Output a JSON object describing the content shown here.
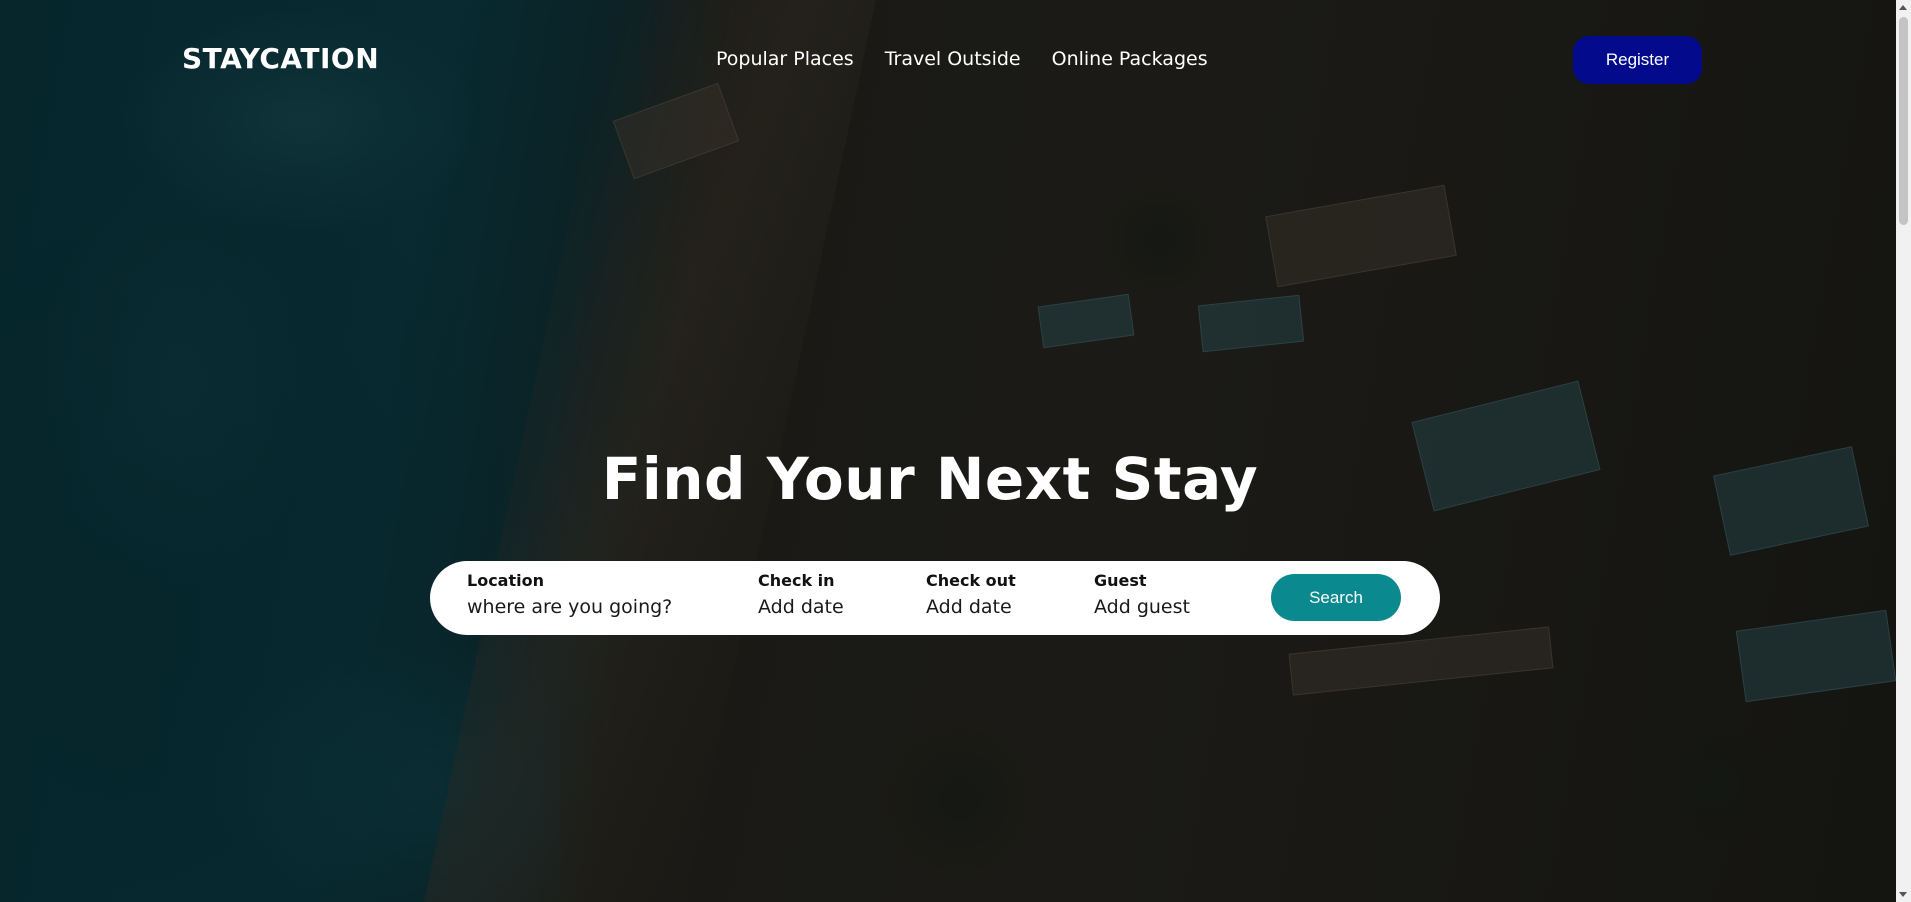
{
  "header": {
    "logo": "STAYCATION",
    "nav": [
      {
        "label": "Popular Places"
      },
      {
        "label": "Travel Outside"
      },
      {
        "label": "Online Packages"
      }
    ],
    "register_label": "Register"
  },
  "hero": {
    "title": "Find Your Next Stay"
  },
  "search": {
    "fields": [
      {
        "label": "Location",
        "value": "where are you going?"
      },
      {
        "label": "Check in",
        "value": "Add date"
      },
      {
        "label": "Check out",
        "value": "Add date"
      },
      {
        "label": "Guest",
        "value": "Add guest"
      }
    ],
    "button_label": "Search"
  },
  "colors": {
    "register_button": "#030a8c",
    "search_button": "#0a8a8f",
    "search_bar": "#ffffff",
    "text": "#ffffff"
  },
  "icons": [
    "scroll-up-arrow-icon",
    "scroll-down-arrow-icon"
  ]
}
